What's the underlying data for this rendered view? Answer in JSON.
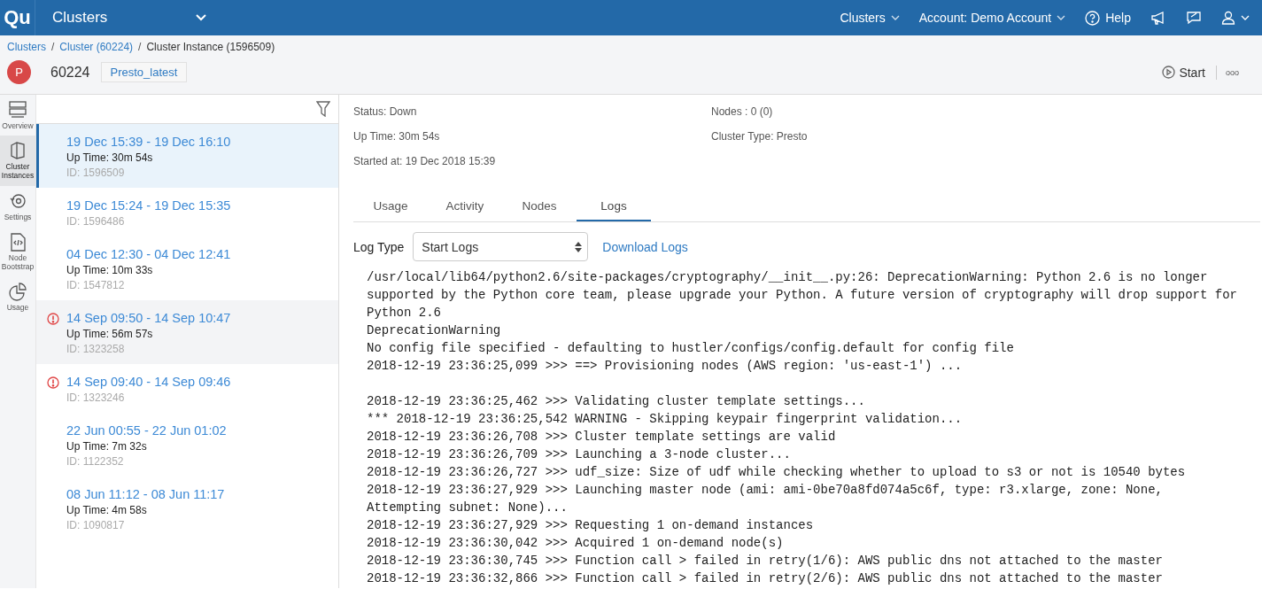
{
  "topbar": {
    "logo": "Qu",
    "title": "Clusters",
    "menus": [
      {
        "kind": "dropdown",
        "label": "Clusters"
      },
      {
        "kind": "dropdown",
        "label": "Account: Demo Account"
      },
      {
        "kind": "help",
        "label": "Help"
      }
    ]
  },
  "breadcrumb_separator": "/",
  "breadcrumbs": [
    {
      "label": "Clusters",
      "link": true
    },
    {
      "label": "Cluster (60224)",
      "link": true
    },
    {
      "label": "Cluster Instance (1596509)",
      "link": false
    }
  ],
  "cluster": {
    "avatar": "P",
    "id": "60224",
    "label": "Presto_latest"
  },
  "actions": {
    "start": "Start",
    "more": "ooo"
  },
  "nav": [
    {
      "label": "Overview",
      "selected": false
    },
    {
      "label": "Cluster Instances",
      "selected": true
    },
    {
      "label": "Settings",
      "selected": false
    },
    {
      "label": "Node Bootstrap",
      "selected": false
    },
    {
      "label": "Usage",
      "selected": false
    }
  ],
  "instances": [
    {
      "range": "19 Dec 15:39 - 19 Dec 16:10",
      "uptime": "Up Time: 30m 54s",
      "id": "ID: 1596509",
      "error": false,
      "selected": true,
      "hovered": false
    },
    {
      "range": "19 Dec 15:24 - 19 Dec 15:35",
      "id": "ID: 1596486",
      "error": false,
      "selected": false,
      "hovered": false
    },
    {
      "range": "04 Dec 12:30 - 04 Dec 12:41",
      "uptime": "Up Time: 10m 33s",
      "id": "ID: 1547812",
      "error": false,
      "selected": false,
      "hovered": false
    },
    {
      "range": "14 Sep 09:50 - 14 Sep 10:47",
      "uptime": "Up Time: 56m 57s",
      "id": "ID: 1323258",
      "error": true,
      "selected": false,
      "hovered": true
    },
    {
      "range": "14 Sep 09:40 - 14 Sep 09:46",
      "id": "ID: 1323246",
      "error": true,
      "selected": false,
      "hovered": false
    },
    {
      "range": "22 Jun 00:55 - 22 Jun 01:02",
      "uptime": "Up Time: 7m 32s",
      "id": "ID: 1122352",
      "error": false,
      "selected": false,
      "hovered": false
    },
    {
      "range": "08 Jun 11:12 - 08 Jun 11:17",
      "uptime": "Up Time: 4m 58s",
      "id": "ID: 1090817",
      "error": false,
      "selected": false,
      "hovered": false
    }
  ],
  "details": {
    "left": [
      "Status: Down",
      "Up Time: 30m 54s",
      "Started at: 19 Dec 2018 15:39"
    ],
    "right": [
      "Nodes : 0 (0)",
      "Cluster Type: Presto"
    ]
  },
  "tabs": [
    {
      "label": "Usage",
      "selected": false
    },
    {
      "label": "Activity",
      "selected": false
    },
    {
      "label": "Nodes",
      "selected": false
    },
    {
      "label": "Logs",
      "selected": true
    }
  ],
  "log_type": {
    "label": "Log Type",
    "value": "Start Logs",
    "download": "Download Logs"
  },
  "log": [
    "/usr/local/lib64/python2.6/site-packages/cryptography/__init__.py:26: DeprecationWarning: Python 2.6 is no longer supported by the Python core team, please upgrade your Python. A future version of cryptography will drop support for Python 2.6",
    "DeprecationWarning",
    "No config file specified - defaulting to hustler/configs/config.default for config file",
    "2018-12-19 23:36:25,099 >>> ==> Provisioning nodes (AWS region: 'us-east-1') ...",
    {
      "kind": "blank"
    },
    "2018-12-19 23:36:25,462 >>> Validating cluster template settings...",
    "*** 2018-12-19 23:36:25,542 WARNING - Skipping keypair fingerprint validation...",
    "2018-12-19 23:36:26,708 >>> Cluster template settings are valid",
    "2018-12-19 23:36:26,709 >>> Launching a 3-node cluster...",
    "2018-12-19 23:36:26,727 >>> udf_size: Size of udf while checking whether to upload to s3 or not is 10540 bytes",
    "2018-12-19 23:36:27,929 >>> Launching master node (ami: ami-0be70a8fd074a5c6f, type: r3.xlarge, zone: None, Attempting subnet: None)...",
    "2018-12-19 23:36:27,929 >>> Requesting 1 on-demand instances",
    "2018-12-19 23:36:30,042 >>> Acquired 1 on-demand node(s)",
    "2018-12-19 23:36:30,745 >>> Function call > failed in retry(1/6): AWS public dns not attached to the master",
    "2018-12-19 23:36:32,866 >>> Function call > failed in retry(2/6): AWS public dns not attached to the master"
  ]
}
